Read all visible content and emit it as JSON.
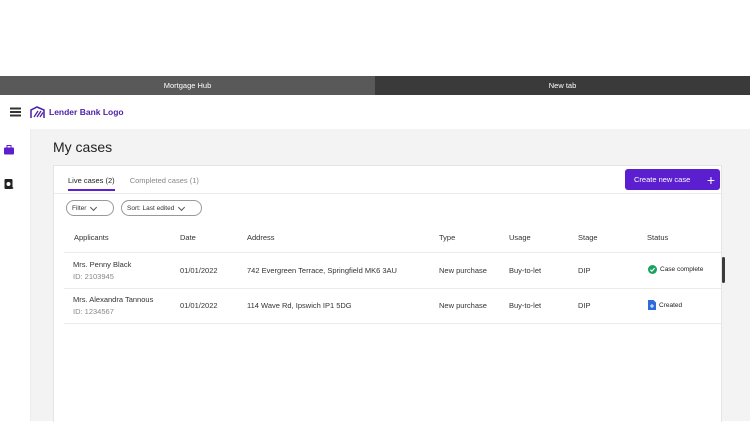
{
  "browser": {
    "tabs": [
      {
        "label": "Mortgage Hub"
      },
      {
        "label": "New tab"
      }
    ]
  },
  "header": {
    "logo_text": "Lender Bank Logo"
  },
  "page": {
    "title": "My cases"
  },
  "cases": {
    "tabs": [
      {
        "label": "Live cases (2)"
      },
      {
        "label": "Completed cases (1)"
      }
    ],
    "create_label": "Create new case",
    "filter_label": "Filter",
    "sort_label": "Sort: Last edited",
    "columns": [
      "Applicants",
      "Date",
      "Address",
      "Type",
      "Usage",
      "Stage",
      "Status"
    ],
    "rows": [
      {
        "name": "Mrs. Penny Black",
        "id": "ID: 2103945",
        "date": "01/01/2022",
        "address": "742 Evergreen Terrace, Springfield MK6 3AU",
        "type": "New purchase",
        "usage": "Buy-to-let",
        "stage": "DIP",
        "status": "Case complete"
      },
      {
        "name": "Mrs. Alexandra Tannous",
        "id": "ID: 1234567",
        "date": "01/01/2022",
        "address": "114 Wave Rd, Ipswich IP1 5DG",
        "type": "New purchase",
        "usage": "Buy-to-let",
        "stage": "DIP",
        "status": "Created"
      }
    ]
  },
  "colors": {
    "accent": "#5b1fd0",
    "success": "#1aa260",
    "info": "#2f6bdc"
  }
}
